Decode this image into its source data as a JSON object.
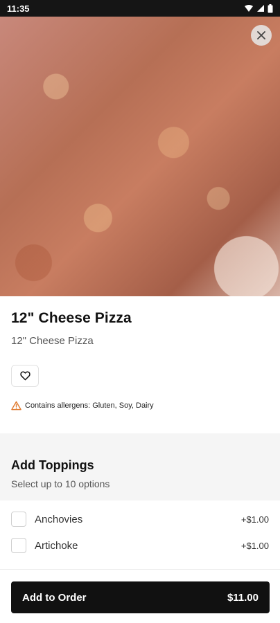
{
  "status_bar": {
    "time": "11:35"
  },
  "hero": {
    "alt": "Cheese pizza close-up",
    "close_icon": "close-icon"
  },
  "item": {
    "title": "12\" Cheese Pizza",
    "subtitle": "12\" Cheese Pizza",
    "favorite_icon": "heart-outline-icon",
    "allergens_text": "Contains allergens: Gluten, Soy, Dairy"
  },
  "toppings": {
    "title": "Add Toppings",
    "subtitle": "Select up to 10 options",
    "options": [
      {
        "label": "Anchovies",
        "price": "+$1.00"
      },
      {
        "label": "Artichoke",
        "price": "+$1.00"
      }
    ]
  },
  "footer": {
    "button_label": "Add to Order",
    "total": "$11.00"
  },
  "colors": {
    "primary": "#111111",
    "warning": "#e07a2f"
  }
}
